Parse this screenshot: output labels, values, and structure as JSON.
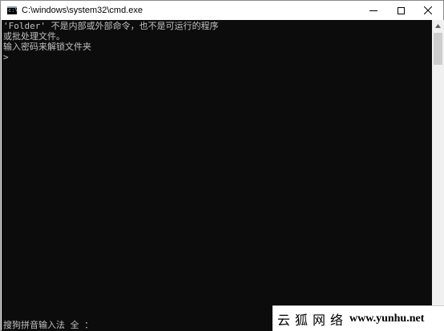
{
  "window": {
    "title": "C:\\windows\\system32\\cmd.exe",
    "icon": "cmd-icon",
    "controls": [
      "minimize-icon",
      "maximize-icon",
      "close-icon"
    ]
  },
  "console": {
    "lines": [
      "'Folder' 不是内部或外部命令，也不是可运行的程序",
      "或批处理文件。",
      "输入密码来解锁文件夹",
      ">"
    ],
    "ime_status": "搜狗拼音输入法 全 ："
  },
  "watermark": {
    "cn_text": "云狐网络",
    "url": "www.yunhu.net"
  },
  "colors": {
    "console_bg": "#0c0c0c",
    "console_fg": "#c0c0c0",
    "titlebar_bg": "#ffffff"
  }
}
